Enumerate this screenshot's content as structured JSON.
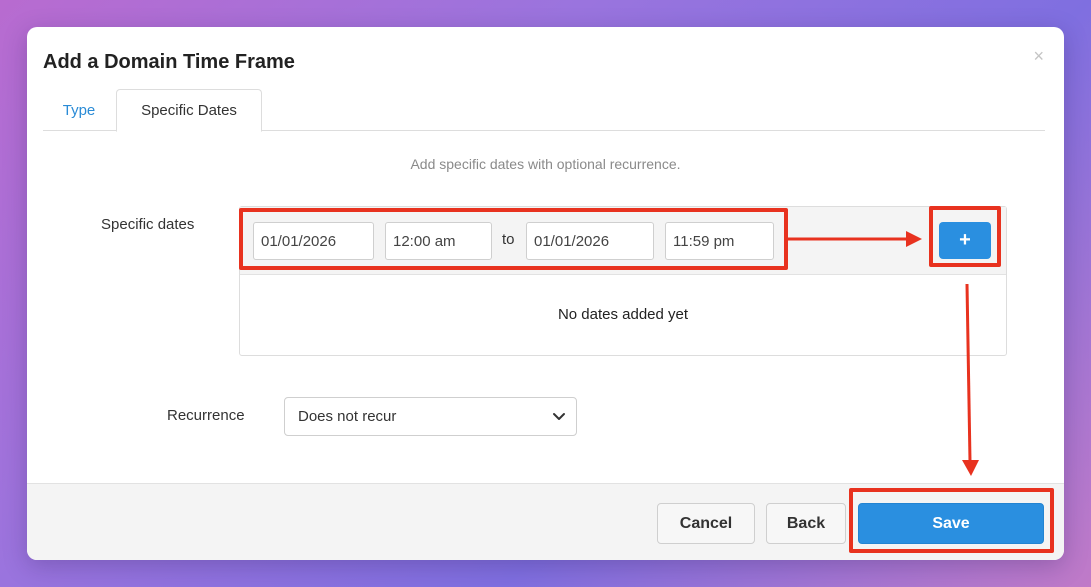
{
  "dialog": {
    "title": "Add a Domain Time Frame",
    "close_glyph": "×"
  },
  "tabs": [
    {
      "label": "Type",
      "active": false
    },
    {
      "label": "Specific Dates",
      "active": true
    }
  ],
  "description": "Add specific dates with optional recurrence.",
  "specific_dates": {
    "label": "Specific dates",
    "start_date": "01/01/2026",
    "start_time": "12:00 am",
    "separator": "to",
    "end_date": "01/01/2026",
    "end_time": "11:59 pm",
    "add_glyph": "+",
    "empty_message": "No dates added yet"
  },
  "recurrence": {
    "label": "Recurrence",
    "selected": "Does not recur"
  },
  "footer": {
    "cancel_label": "Cancel",
    "back_label": "Back",
    "save_label": "Save"
  },
  "colors": {
    "accent": "#2a8fe0",
    "link": "#2a8bd6",
    "annotation": "#e8321f"
  },
  "icons": {
    "close": "close-icon",
    "add": "plus-icon",
    "dropdown": "chevron-down-icon"
  }
}
